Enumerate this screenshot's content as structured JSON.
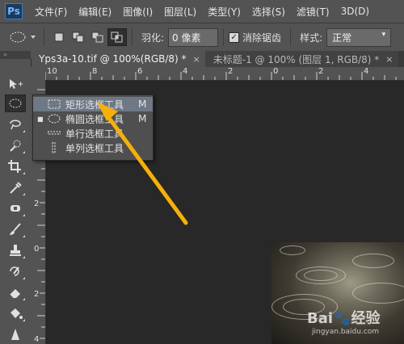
{
  "app": {
    "logo": "Ps"
  },
  "menubar": {
    "items": [
      "文件(F)",
      "编辑(E)",
      "图像(I)",
      "图层(L)",
      "类型(Y)",
      "选择(S)",
      "滤镜(T)",
      "3D(D)"
    ]
  },
  "options": {
    "feather_label": "羽化:",
    "feather_value": "0 像素",
    "antialias_label": "消除锯齿",
    "antialias_checked": true,
    "style_label": "样式:",
    "style_value": "正常"
  },
  "toolbox_header": "»",
  "tabs": [
    {
      "label": "Yps3a-10.tif @ 100%(RGB/8) *",
      "close": "×",
      "active": true
    },
    {
      "label": "未标题-1 @ 100% (图层 1, RGB/8) *",
      "close": "×",
      "active": false
    }
  ],
  "ruler_top": [
    "10",
    "8",
    "6",
    "4",
    "2",
    "0",
    "2",
    "4"
  ],
  "ruler_left": [
    "2",
    "0",
    "2",
    "4"
  ],
  "flyout": [
    {
      "label": "矩形选框工具",
      "key": "M",
      "icon": "rect-marquee-icon",
      "active": false,
      "highlight": true
    },
    {
      "label": "椭圆选框工具",
      "key": "M",
      "icon": "ellipse-marquee-icon",
      "active": true,
      "highlight": false
    },
    {
      "label": "单行选框工具",
      "key": "",
      "icon": "single-row-marquee-icon",
      "active": false,
      "highlight": false
    },
    {
      "label": "单列选框工具",
      "key": "",
      "icon": "single-column-marquee-icon",
      "active": false,
      "highlight": false
    }
  ],
  "watermark": {
    "brand": "Bai",
    "sub": "jingyan.baidu.com",
    "suffix": "经验"
  },
  "colors": {
    "arrow": "#f5b00a",
    "menu_bg": "#535353",
    "canvas_bg": "#282828",
    "highlight": "#6f7885"
  }
}
